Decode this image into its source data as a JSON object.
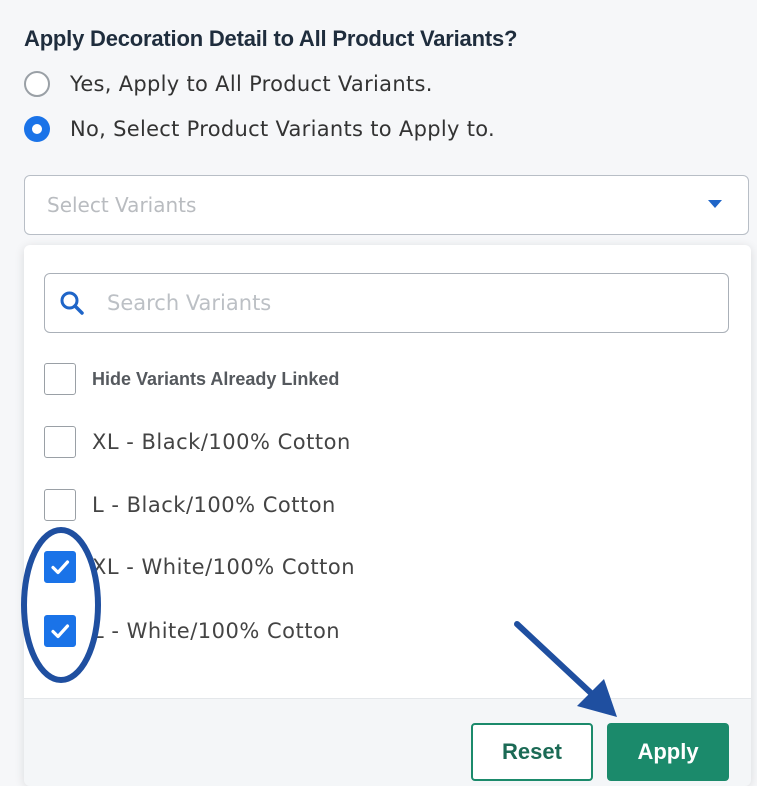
{
  "question": "Apply Decoration Detail to All Product Variants?",
  "radio_options": [
    {
      "label": "Yes, Apply to All Product Variants.",
      "checked": false
    },
    {
      "label": "No, Select Product Variants to Apply to.",
      "checked": true
    }
  ],
  "select": {
    "placeholder": "Select Variants"
  },
  "dropdown": {
    "search_placeholder": "Search Variants",
    "hide_linked_label": "Hide Variants Already Linked",
    "variants": [
      {
        "label": "XL - Black/100% Cotton",
        "checked": false
      },
      {
        "label": "L - Black/100% Cotton",
        "checked": false
      },
      {
        "label": "XL - White/100% Cotton",
        "checked": true
      },
      {
        "label": "L - White/100% Cotton",
        "checked": true
      }
    ],
    "reset_label": "Reset",
    "apply_label": "Apply"
  },
  "colors": {
    "accent": "#1a73e8",
    "primary_button": "#1b8a6b",
    "annotation": "#1f4fa0"
  },
  "icons": {
    "search": "search-icon",
    "caret": "chevron-down-icon",
    "check": "check-icon"
  }
}
